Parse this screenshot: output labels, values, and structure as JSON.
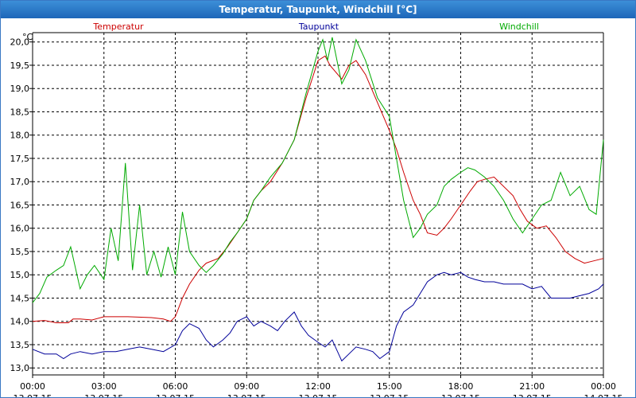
{
  "window": {
    "title": "Temperatur, Taupunkt, Windchill [°C]"
  },
  "chart_data": {
    "type": "line",
    "title": "Temperatur, Taupunkt, Windchill [°C]",
    "ylabel": "°C",
    "ylim": [
      12.85,
      20.2
    ],
    "xlim": [
      0,
      24
    ],
    "grid": true,
    "legend_position": "top",
    "y_ticks": [
      13.0,
      13.5,
      14.0,
      14.5,
      15.0,
      15.5,
      16.0,
      16.5,
      17.0,
      17.5,
      18.0,
      18.5,
      19.0,
      19.5,
      20.0
    ],
    "y_tick_labels": [
      "13,0",
      "13,5",
      "14,0",
      "14,5",
      "15,0",
      "15,5",
      "16,0",
      "16,5",
      "17,0",
      "17,5",
      "18,0",
      "18,5",
      "19,0",
      "19,5",
      "20,0"
    ],
    "x_ticks": [
      {
        "hour": 0,
        "time": "00:00",
        "date": "13.07.15"
      },
      {
        "hour": 3,
        "time": "03:00",
        "date": "13.07.15"
      },
      {
        "hour": 6,
        "time": "06:00",
        "date": "13.07.15"
      },
      {
        "hour": 9,
        "time": "09:00",
        "date": "13.07.15"
      },
      {
        "hour": 12,
        "time": "12:00",
        "date": "13.07.15"
      },
      {
        "hour": 15,
        "time": "15:00",
        "date": "13.07.15"
      },
      {
        "hour": 18,
        "time": "18:00",
        "date": "13.07.15"
      },
      {
        "hour": 21,
        "time": "21:00",
        "date": "13.07.15"
      },
      {
        "hour": 24,
        "time": "00:00",
        "date": "14.07.15"
      }
    ],
    "series": [
      {
        "name": "Temperatur",
        "color": "#cc0000",
        "points": [
          [
            0,
            14.0
          ],
          [
            0.5,
            14.02
          ],
          [
            1,
            13.97
          ],
          [
            1.5,
            13.97
          ],
          [
            1.7,
            14.05
          ],
          [
            2,
            14.05
          ],
          [
            2.5,
            14.03
          ],
          [
            3,
            14.1
          ],
          [
            4,
            14.1
          ],
          [
            5,
            14.08
          ],
          [
            5.5,
            14.05
          ],
          [
            5.8,
            14.0
          ],
          [
            6,
            14.1
          ],
          [
            6.3,
            14.5
          ],
          [
            6.6,
            14.8
          ],
          [
            7,
            15.1
          ],
          [
            7.3,
            15.25
          ],
          [
            7.8,
            15.35
          ],
          [
            8.2,
            15.6
          ],
          [
            8.6,
            15.9
          ],
          [
            9,
            16.2
          ],
          [
            9.3,
            16.6
          ],
          [
            9.6,
            16.8
          ],
          [
            10,
            17.0
          ],
          [
            10.5,
            17.4
          ],
          [
            11,
            17.9
          ],
          [
            11.5,
            18.8
          ],
          [
            12,
            19.6
          ],
          [
            12.3,
            19.7
          ],
          [
            12.5,
            19.5
          ],
          [
            13,
            19.2
          ],
          [
            13.3,
            19.5
          ],
          [
            13.6,
            19.6
          ],
          [
            14,
            19.3
          ],
          [
            14.5,
            18.7
          ],
          [
            15,
            18.1
          ],
          [
            15.3,
            17.7
          ],
          [
            15.6,
            17.2
          ],
          [
            16,
            16.6
          ],
          [
            16.3,
            16.3
          ],
          [
            16.6,
            15.9
          ],
          [
            17,
            15.85
          ],
          [
            17.3,
            16.0
          ],
          [
            17.6,
            16.2
          ],
          [
            18,
            16.5
          ],
          [
            18.4,
            16.8
          ],
          [
            18.7,
            17.0
          ],
          [
            19,
            17.05
          ],
          [
            19.4,
            17.1
          ],
          [
            19.8,
            16.9
          ],
          [
            20.2,
            16.7
          ],
          [
            20.5,
            16.4
          ],
          [
            20.8,
            16.15
          ],
          [
            21.2,
            16.0
          ],
          [
            21.6,
            16.05
          ],
          [
            22,
            15.8
          ],
          [
            22.4,
            15.5
          ],
          [
            22.8,
            15.35
          ],
          [
            23.2,
            15.25
          ],
          [
            23.6,
            15.3
          ],
          [
            24,
            15.35
          ]
        ]
      },
      {
        "name": "Taupunkt",
        "color": "#000099",
        "points": [
          [
            0,
            13.4
          ],
          [
            0.5,
            13.3
          ],
          [
            1,
            13.3
          ],
          [
            1.3,
            13.2
          ],
          [
            1.6,
            13.3
          ],
          [
            2,
            13.35
          ],
          [
            2.5,
            13.3
          ],
          [
            3,
            13.35
          ],
          [
            3.5,
            13.35
          ],
          [
            4,
            13.4
          ],
          [
            4.5,
            13.45
          ],
          [
            5,
            13.4
          ],
          [
            5.5,
            13.35
          ],
          [
            6,
            13.5
          ],
          [
            6.3,
            13.8
          ],
          [
            6.6,
            13.95
          ],
          [
            7,
            13.85
          ],
          [
            7.3,
            13.6
          ],
          [
            7.6,
            13.45
          ],
          [
            8,
            13.6
          ],
          [
            8.3,
            13.75
          ],
          [
            8.6,
            14.0
          ],
          [
            9,
            14.1
          ],
          [
            9.3,
            13.9
          ],
          [
            9.6,
            14.0
          ],
          [
            10,
            13.9
          ],
          [
            10.3,
            13.8
          ],
          [
            10.6,
            14.0
          ],
          [
            11,
            14.2
          ],
          [
            11.3,
            13.9
          ],
          [
            11.6,
            13.7
          ],
          [
            12,
            13.55
          ],
          [
            12.3,
            13.45
          ],
          [
            12.6,
            13.6
          ],
          [
            13,
            13.15
          ],
          [
            13.3,
            13.3
          ],
          [
            13.6,
            13.45
          ],
          [
            14,
            13.4
          ],
          [
            14.3,
            13.35
          ],
          [
            14.6,
            13.2
          ],
          [
            15,
            13.35
          ],
          [
            15.3,
            13.9
          ],
          [
            15.6,
            14.2
          ],
          [
            16,
            14.35
          ],
          [
            16.3,
            14.6
          ],
          [
            16.6,
            14.85
          ],
          [
            17,
            15.0
          ],
          [
            17.3,
            15.05
          ],
          [
            17.6,
            15.0
          ],
          [
            18,
            15.05
          ],
          [
            18.3,
            14.95
          ],
          [
            18.6,
            14.9
          ],
          [
            19,
            14.85
          ],
          [
            19.4,
            14.85
          ],
          [
            19.8,
            14.8
          ],
          [
            20.2,
            14.8
          ],
          [
            20.6,
            14.8
          ],
          [
            21,
            14.7
          ],
          [
            21.4,
            14.75
          ],
          [
            21.8,
            14.5
          ],
          [
            22.2,
            14.5
          ],
          [
            22.6,
            14.5
          ],
          [
            23,
            14.55
          ],
          [
            23.4,
            14.6
          ],
          [
            23.8,
            14.7
          ],
          [
            24,
            14.8
          ]
        ]
      },
      {
        "name": "Windchill",
        "color": "#00aa00",
        "points": [
          [
            0,
            14.4
          ],
          [
            0.3,
            14.6
          ],
          [
            0.6,
            14.95
          ],
          [
            1,
            15.1
          ],
          [
            1.3,
            15.2
          ],
          [
            1.6,
            15.6
          ],
          [
            2,
            14.7
          ],
          [
            2.3,
            15.0
          ],
          [
            2.6,
            15.2
          ],
          [
            3,
            14.9
          ],
          [
            3.3,
            16.0
          ],
          [
            3.6,
            15.3
          ],
          [
            3.9,
            17.4
          ],
          [
            4.2,
            15.1
          ],
          [
            4.5,
            16.5
          ],
          [
            4.8,
            15.0
          ],
          [
            5.1,
            15.5
          ],
          [
            5.4,
            14.95
          ],
          [
            5.7,
            15.6
          ],
          [
            6,
            15.0
          ],
          [
            6.3,
            16.35
          ],
          [
            6.6,
            15.5
          ],
          [
            7,
            15.2
          ],
          [
            7.3,
            15.05
          ],
          [
            7.6,
            15.2
          ],
          [
            8,
            15.45
          ],
          [
            8.3,
            15.7
          ],
          [
            8.6,
            15.9
          ],
          [
            9,
            16.2
          ],
          [
            9.3,
            16.6
          ],
          [
            9.6,
            16.8
          ],
          [
            10,
            17.1
          ],
          [
            10.5,
            17.4
          ],
          [
            11,
            17.9
          ],
          [
            11.5,
            18.9
          ],
          [
            12,
            19.8
          ],
          [
            12.2,
            20.05
          ],
          [
            12.4,
            19.6
          ],
          [
            12.6,
            20.1
          ],
          [
            13,
            19.1
          ],
          [
            13.3,
            19.4
          ],
          [
            13.6,
            20.05
          ],
          [
            14,
            19.6
          ],
          [
            14.5,
            18.8
          ],
          [
            15,
            18.4
          ],
          [
            15.3,
            17.5
          ],
          [
            15.6,
            16.6
          ],
          [
            16,
            15.8
          ],
          [
            16.3,
            16.0
          ],
          [
            16.6,
            16.3
          ],
          [
            17,
            16.5
          ],
          [
            17.3,
            16.9
          ],
          [
            17.6,
            17.05
          ],
          [
            18,
            17.2
          ],
          [
            18.3,
            17.3
          ],
          [
            18.6,
            17.25
          ],
          [
            19,
            17.1
          ],
          [
            19.4,
            16.9
          ],
          [
            19.8,
            16.6
          ],
          [
            20.2,
            16.2
          ],
          [
            20.6,
            15.9
          ],
          [
            21,
            16.2
          ],
          [
            21.4,
            16.5
          ],
          [
            21.8,
            16.6
          ],
          [
            22.2,
            17.2
          ],
          [
            22.6,
            16.7
          ],
          [
            23,
            16.9
          ],
          [
            23.4,
            16.4
          ],
          [
            23.7,
            16.3
          ],
          [
            24,
            17.9
          ]
        ]
      }
    ]
  }
}
